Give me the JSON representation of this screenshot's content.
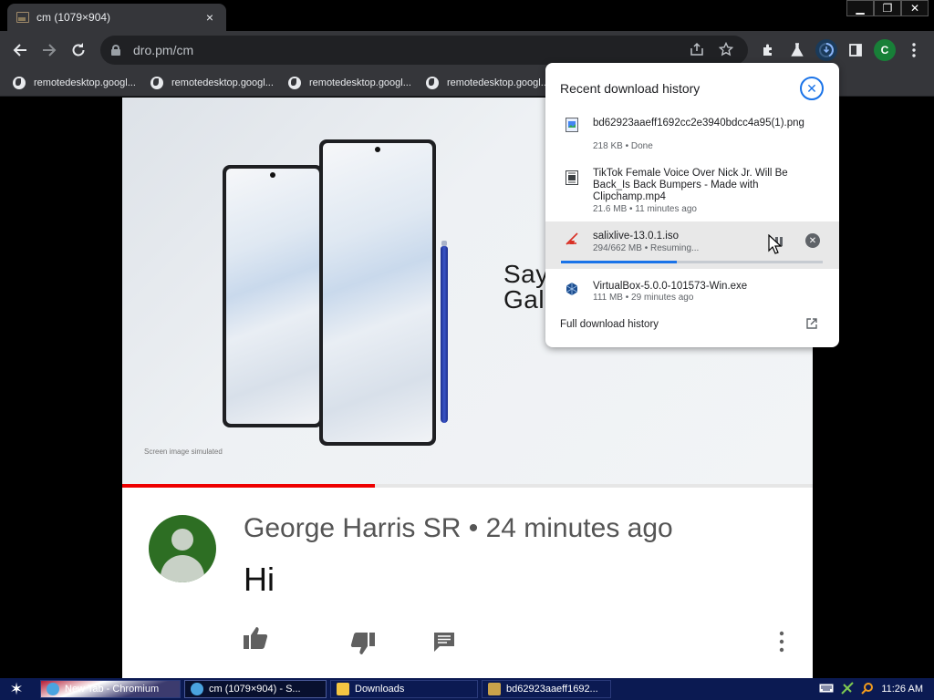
{
  "browser": {
    "tab": {
      "title": "cm (1079×904)",
      "close": "×"
    },
    "window_controls": {
      "minimize": "▁",
      "restore": "❐",
      "close": "✕"
    },
    "url": "dro.pm/cm",
    "profile_initial": "C"
  },
  "bookmarks": [
    {
      "label": "remotedesktop.googl..."
    },
    {
      "label": "remotedesktop.googl..."
    },
    {
      "label": "remotedesktop.googl..."
    },
    {
      "label": "remotedesktop.googl..."
    }
  ],
  "video": {
    "promo_text_line1": "Say",
    "promo_text_line2": "Gal",
    "fine_print": "Screen image simulated",
    "progress": 0.366
  },
  "comment": {
    "author_line": "George Harris SR • 24 minutes ago",
    "text": "Hi"
  },
  "downloads": {
    "header": "Recent download history",
    "items": [
      {
        "name": "bd62923aaeff1692cc2e3940bdcc4a95(1).png",
        "meta": "218 KB • Done",
        "icon": "image-file-icon"
      },
      {
        "name": "TikTok Female Voice Over Nick Jr. Will Be Back_Is Back Bumpers - Made with Clipchamp.mp4",
        "meta": "21.6 MB • 11 minutes ago",
        "icon": "video-file-icon"
      },
      {
        "name": "salixlive-13.0.1.iso",
        "meta": "294/662 MB • Resuming...",
        "icon": "disc-error-icon",
        "progress": 0.444
      },
      {
        "name": "VirtualBox-5.0.0-101573-Win.exe",
        "meta": "111 MB • 29 minutes ago",
        "icon": "virtualbox-icon"
      }
    ],
    "full_history": "Full download history"
  },
  "taskbar": {
    "items": [
      {
        "label": "New Tab - Chromium"
      },
      {
        "label": "cm (1079×904) - S..."
      },
      {
        "label": "Downloads"
      },
      {
        "label": "bd62923aaeff1692..."
      }
    ],
    "clock": "11:26 AM"
  },
  "colors": {
    "accent": "#1a73e8",
    "toolbar": "#35363a",
    "video_progress": "#e00000",
    "avatar": "#2d6e23",
    "taskbar": "#0b1a52"
  }
}
